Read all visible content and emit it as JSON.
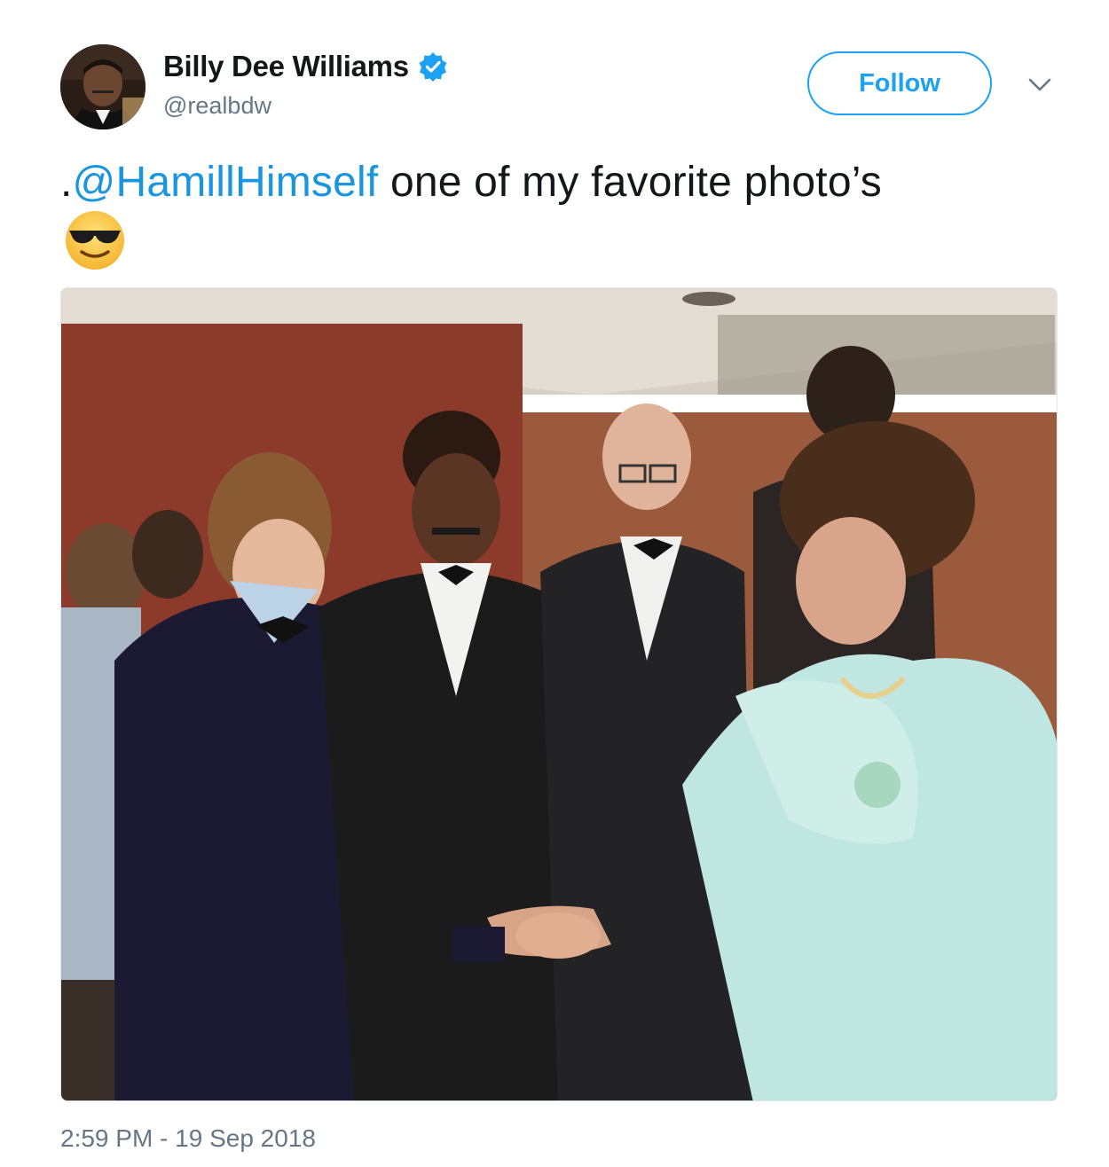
{
  "author": {
    "display_name": "Billy Dee Williams",
    "handle": "@realbdw",
    "verified": true,
    "avatar_icon": "profile-photo"
  },
  "actions": {
    "follow_label": "Follow",
    "menu_icon": "chevron-down-icon"
  },
  "tweet": {
    "prefix": ".",
    "mention": "@HamillHimself",
    "text": " one of my favorite photo’s",
    "emoji": "smiling-face-with-sunglasses"
  },
  "media": {
    "type": "photo",
    "description_icon": "event-photo"
  },
  "meta": {
    "timestamp": "2:59 PM - 19 Sep 2018"
  },
  "colors": {
    "accent": "#1da1f2",
    "mention": "#1b95e0",
    "text": "#14171a",
    "secondary": "#657786"
  }
}
